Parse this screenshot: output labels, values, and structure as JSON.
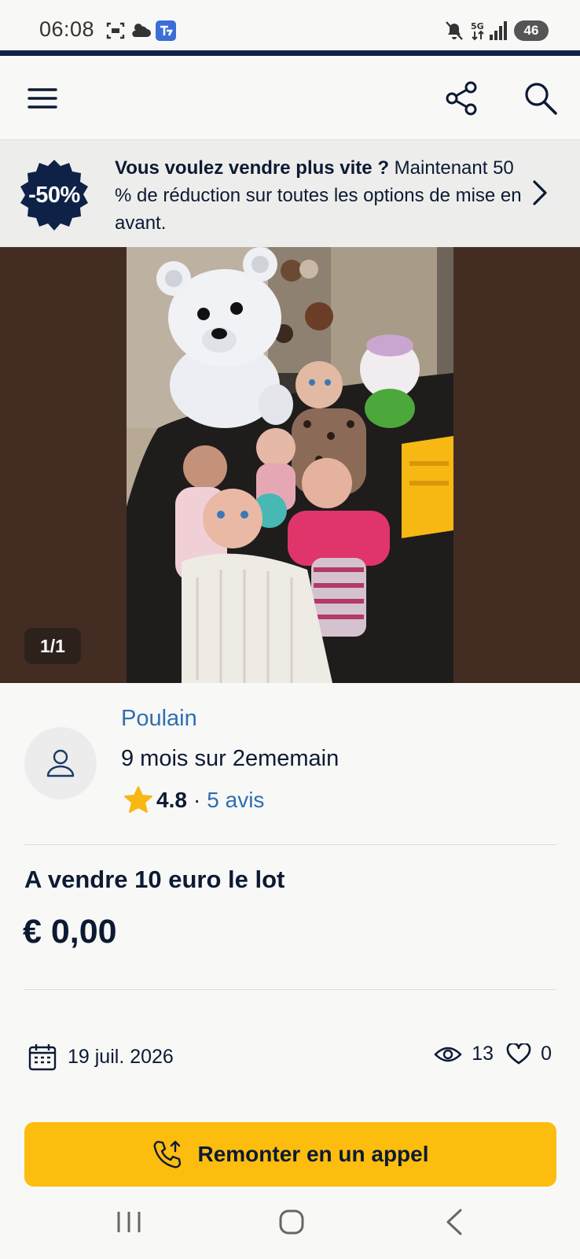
{
  "status_bar": {
    "time": "06:08",
    "network": "5G",
    "battery": "46",
    "icons": [
      "screenshot-icon",
      "cloud-icon",
      "app-notification-icon",
      "mute-icon",
      "signal-icon"
    ]
  },
  "header": {
    "icons": [
      "menu-icon",
      "share-icon",
      "search-icon"
    ]
  },
  "promo": {
    "badge": "-50%",
    "headline": "Vous voulez vendre plus vite ?",
    "body": " Maintenant 50 % de réduction sur toutes les options de mise en avant.",
    "badge_color": "#0e2247"
  },
  "gallery": {
    "counter": "1/1",
    "background_color": "#432d23"
  },
  "seller": {
    "name": "Poulain",
    "member_since": "9 mois sur 2ememain",
    "rating": "4.8",
    "separator": "·",
    "reviews": "5 avis"
  },
  "listing": {
    "title": "A vendre 10 euro le lot",
    "price": "€ 0,00"
  },
  "meta": {
    "date": "19 juil. 2026",
    "views": "13",
    "favorites": "0"
  },
  "cta": {
    "label": "Remonter en un appel",
    "color": "#fdbd0f"
  },
  "system_nav": {
    "icons": [
      "recents-icon",
      "home-icon",
      "back-icon"
    ]
  }
}
